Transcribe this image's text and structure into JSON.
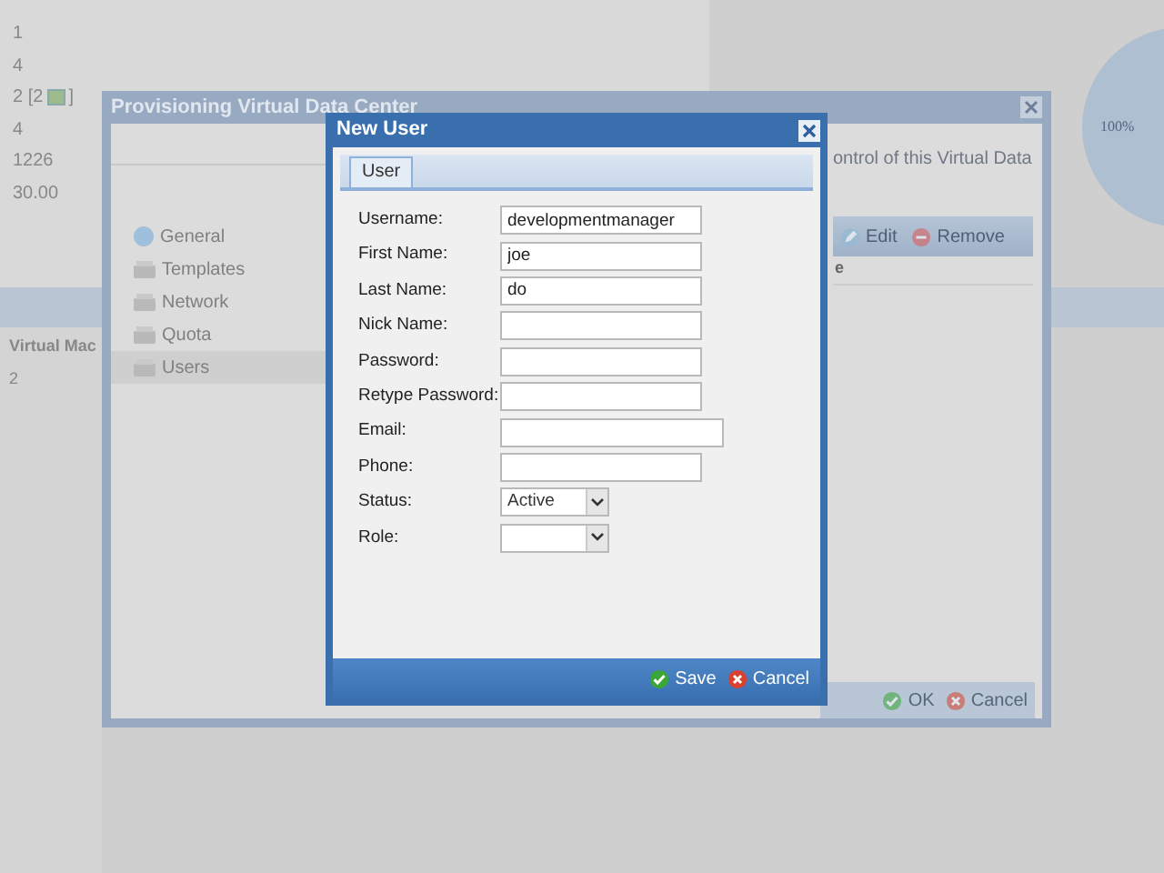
{
  "background": {
    "values": [
      {
        "text": "1"
      },
      {
        "text": "4"
      },
      {
        "text": "2 [2",
        "badge": true,
        "after": "]"
      },
      {
        "text": "4"
      },
      {
        "text": "1226"
      },
      {
        "text": "30.00"
      }
    ],
    "section_label": "Virtual Mac",
    "section_value": "2",
    "pie_label": "100%"
  },
  "dialog": {
    "title": "Provisioning Virtual Data Center",
    "nav": [
      {
        "label": "General",
        "kind": "globe",
        "selected": false
      },
      {
        "label": "Templates",
        "kind": "drive",
        "selected": false
      },
      {
        "label": "Network",
        "kind": "drive",
        "selected": false
      },
      {
        "label": "Quota",
        "kind": "drive",
        "selected": false
      },
      {
        "label": "Users",
        "kind": "drive",
        "selected": true
      }
    ],
    "description": "ontrol of this Virtual Data",
    "toolbar": [
      {
        "label": "Edit",
        "kind": "edit"
      },
      {
        "label": "Remove",
        "kind": "remove"
      }
    ],
    "column_1": "e",
    "buttons": [
      {
        "label": "OK",
        "kind": "confirm"
      },
      {
        "label": "Cancel",
        "kind": "cancel"
      }
    ]
  },
  "modal": {
    "title": "New User",
    "tabs": [
      {
        "label": "User",
        "selected": true
      }
    ],
    "fields": [
      {
        "label": "Username:",
        "kind": "text",
        "value": "developmentmanager"
      },
      {
        "label": "First Name:",
        "kind": "text",
        "value": "joe"
      },
      {
        "label": "Last Name:",
        "kind": "text",
        "value": "do"
      },
      {
        "label": "Nick Name:",
        "kind": "text"
      },
      {
        "label": "Password:",
        "kind": "text"
      },
      {
        "label": "Retype Password:",
        "kind": "text"
      },
      {
        "label": "Email:",
        "kind": "email"
      },
      {
        "label": "Phone:",
        "kind": "text"
      },
      {
        "label": "Status:",
        "kind": "select",
        "value": "Active"
      },
      {
        "label": "Role:",
        "kind": "select"
      }
    ],
    "buttons": [
      {
        "label": "Save",
        "kind": "confirm"
      },
      {
        "label": "Cancel",
        "kind": "cancel"
      }
    ]
  }
}
